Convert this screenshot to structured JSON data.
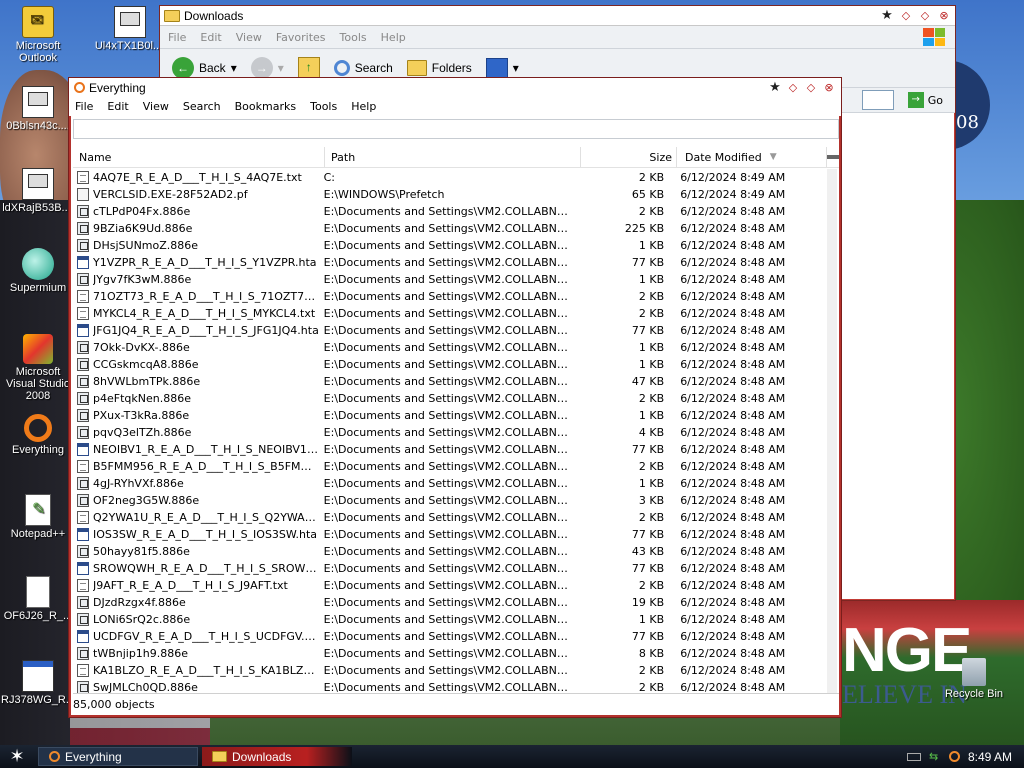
{
  "desktop": {
    "icons": [
      {
        "label": "Microsoft Outlook",
        "icon": "outlook-icon"
      },
      {
        "label": "Ul4xTX1B0l....",
        "icon": "exe-icon"
      },
      {
        "label": "0Bblsn43c....",
        "icon": "exe-icon"
      },
      {
        "label": "ldXRajB53B....",
        "icon": "exe-icon"
      },
      {
        "label": "Supermium",
        "icon": "browser-icon"
      },
      {
        "label": "Microsoft Visual Studio 2008",
        "icon": "visual-studio-icon"
      },
      {
        "label": "Everything",
        "icon": "everything-icon"
      },
      {
        "label": "Notepad++",
        "icon": "notepad-plus-plus-icon"
      },
      {
        "label": "OF6J26_R_...",
        "icon": "document-icon"
      },
      {
        "label": "RJ378WG_R...",
        "icon": "window-icon"
      },
      {
        "label": "Recycle Bin",
        "icon": "recycle-bin-icon"
      }
    ],
    "wallpaper_text": {
      "headline": "NGE",
      "tagline": "ELIEVE IN",
      "badge": "08"
    }
  },
  "downloads_window": {
    "title": "Downloads",
    "menu": [
      "File",
      "Edit",
      "View",
      "Favorites",
      "Tools",
      "Help"
    ],
    "toolbar": {
      "back": "Back",
      "search": "Search",
      "folders": "Folders"
    },
    "go": "Go"
  },
  "everything_window": {
    "title": "Everything",
    "menu": [
      "File",
      "Edit",
      "View",
      "Search",
      "Bookmarks",
      "Tools",
      "Help"
    ],
    "search_value": "",
    "columns": {
      "name": "Name",
      "path": "Path",
      "size": "Size",
      "date": "Date Modified"
    },
    "rows": [
      {
        "icon": "txt",
        "name": "4AQ7E_R_E_A_D___T_H_I_S_4AQ7E.txt",
        "path": "C:",
        "size": "2 KB",
        "date": "6/12/2024 8:49 AM"
      },
      {
        "icon": "pf",
        "name": "VERCLSID.EXE-28F52AD2.pf",
        "path": "E:\\WINDOWS\\Prefetch",
        "size": "65 KB",
        "date": "6/12/2024 8:49 AM"
      },
      {
        "icon": "e886",
        "name": "cTLPdP04Fx.886e",
        "path": "E:\\Documents and Settings\\VM2.COLLABNET\\Ap...",
        "size": "2 KB",
        "date": "6/12/2024 8:48 AM"
      },
      {
        "icon": "e886",
        "name": "9BZia6K9Ud.886e",
        "path": "E:\\Documents and Settings\\VM2.COLLABNET\\Ap...",
        "size": "225 KB",
        "date": "6/12/2024 8:48 AM"
      },
      {
        "icon": "e886",
        "name": "DHsjSUNmoZ.886e",
        "path": "E:\\Documents and Settings\\VM2.COLLABNET\\Ap...",
        "size": "1 KB",
        "date": "6/12/2024 8:48 AM"
      },
      {
        "icon": "hta",
        "name": "Y1VZPR_R_E_A_D___T_H_I_S_Y1VZPR.hta",
        "path": "E:\\Documents and Settings\\VM2.COLLABNET\\Ap...",
        "size": "77 KB",
        "date": "6/12/2024 8:48 AM"
      },
      {
        "icon": "e886",
        "name": "JYgv7fK3wM.886e",
        "path": "E:\\Documents and Settings\\VM2.COLLABNET\\Ap...",
        "size": "1 KB",
        "date": "6/12/2024 8:48 AM"
      },
      {
        "icon": "txt",
        "name": "71OZT73_R_E_A_D___T_H_I_S_71OZT73.txt",
        "path": "E:\\Documents and Settings\\VM2.COLLABNET\\Ap...",
        "size": "2 KB",
        "date": "6/12/2024 8:48 AM"
      },
      {
        "icon": "txt",
        "name": "MYKCL4_R_E_A_D___T_H_I_S_MYKCL4.txt",
        "path": "E:\\Documents and Settings\\VM2.COLLABNET\\Ap...",
        "size": "2 KB",
        "date": "6/12/2024 8:48 AM"
      },
      {
        "icon": "hta",
        "name": "JFG1JQ4_R_E_A_D___T_H_I_S_JFG1JQ4.hta",
        "path": "E:\\Documents and Settings\\VM2.COLLABNET\\Ap...",
        "size": "77 KB",
        "date": "6/12/2024 8:48 AM"
      },
      {
        "icon": "e886",
        "name": "7Okk-DvKX-.886e",
        "path": "E:\\Documents and Settings\\VM2.COLLABNET\\Ap...",
        "size": "1 KB",
        "date": "6/12/2024 8:48 AM"
      },
      {
        "icon": "e886",
        "name": "CCGskmcqA8.886e",
        "path": "E:\\Documents and Settings\\VM2.COLLABNET\\Ap...",
        "size": "1 KB",
        "date": "6/12/2024 8:48 AM"
      },
      {
        "icon": "e886",
        "name": "8hVWLbmTPk.886e",
        "path": "E:\\Documents and Settings\\VM2.COLLABNET\\Ap...",
        "size": "47 KB",
        "date": "6/12/2024 8:48 AM"
      },
      {
        "icon": "e886",
        "name": "p4eFtqkNen.886e",
        "path": "E:\\Documents and Settings\\VM2.COLLABNET\\Ap...",
        "size": "2 KB",
        "date": "6/12/2024 8:48 AM"
      },
      {
        "icon": "e886",
        "name": "PXux-T3kRa.886e",
        "path": "E:\\Documents and Settings\\VM2.COLLABNET\\Ap...",
        "size": "1 KB",
        "date": "6/12/2024 8:48 AM"
      },
      {
        "icon": "e886",
        "name": "pqvQ3elTZh.886e",
        "path": "E:\\Documents and Settings\\VM2.COLLABNET\\Ap...",
        "size": "4 KB",
        "date": "6/12/2024 8:48 AM"
      },
      {
        "icon": "hta",
        "name": "NEOIBV1_R_E_A_D___T_H_I_S_NEOIBV1.hta",
        "path": "E:\\Documents and Settings\\VM2.COLLABNET\\Ap...",
        "size": "77 KB",
        "date": "6/12/2024 8:48 AM"
      },
      {
        "icon": "txt",
        "name": "B5FMM956_R_E_A_D___T_H_I_S_B5FMM956...",
        "path": "E:\\Documents and Settings\\VM2.COLLABNET\\Ap...",
        "size": "2 KB",
        "date": "6/12/2024 8:48 AM"
      },
      {
        "icon": "e886",
        "name": "4gJ-RYhVXf.886e",
        "path": "E:\\Documents and Settings\\VM2.COLLABNET\\Ap...",
        "size": "1 KB",
        "date": "6/12/2024 8:48 AM"
      },
      {
        "icon": "e886",
        "name": "OF2neg3G5W.886e",
        "path": "E:\\Documents and Settings\\VM2.COLLABNET\\Ap...",
        "size": "3 KB",
        "date": "6/12/2024 8:48 AM"
      },
      {
        "icon": "txt",
        "name": "Q2YWA1U_R_E_A_D___T_H_I_S_Q2YWA1U....",
        "path": "E:\\Documents and Settings\\VM2.COLLABNET\\Ap...",
        "size": "2 KB",
        "date": "6/12/2024 8:48 AM"
      },
      {
        "icon": "hta",
        "name": "IOS3SW_R_E_A_D___T_H_I_S_IOS3SW.hta",
        "path": "E:\\Documents and Settings\\VM2.COLLABNET\\Ap...",
        "size": "77 KB",
        "date": "6/12/2024 8:48 AM"
      },
      {
        "icon": "e886",
        "name": "50hayy81f5.886e",
        "path": "E:\\Documents and Settings\\VM2.COLLABNET\\Ap...",
        "size": "43 KB",
        "date": "6/12/2024 8:48 AM"
      },
      {
        "icon": "hta",
        "name": "SROWQWH_R_E_A_D___T_H_I_S_SROWQ...",
        "path": "E:\\Documents and Settings\\VM2.COLLABNET\\Ap...",
        "size": "77 KB",
        "date": "6/12/2024 8:48 AM"
      },
      {
        "icon": "txt",
        "name": "J9AFT_R_E_A_D___T_H_I_S_J9AFT.txt",
        "path": "E:\\Documents and Settings\\VM2.COLLABNET\\Ap...",
        "size": "2 KB",
        "date": "6/12/2024 8:48 AM"
      },
      {
        "icon": "e886",
        "name": "DJzdRzgx4f.886e",
        "path": "E:\\Documents and Settings\\VM2.COLLABNET\\Ap...",
        "size": "19 KB",
        "date": "6/12/2024 8:48 AM"
      },
      {
        "icon": "e886",
        "name": "LONi6SrQ2c.886e",
        "path": "E:\\Documents and Settings\\VM2.COLLABNET\\Ap...",
        "size": "1 KB",
        "date": "6/12/2024 8:48 AM"
      },
      {
        "icon": "hta",
        "name": "UCDFGV_R_E_A_D___T_H_I_S_UCDFGV.hta",
        "path": "E:\\Documents and Settings\\VM2.COLLABNET\\Ap...",
        "size": "77 KB",
        "date": "6/12/2024 8:48 AM"
      },
      {
        "icon": "e886",
        "name": "tWBnjip1h9.886e",
        "path": "E:\\Documents and Settings\\VM2.COLLABNET\\Ap...",
        "size": "8 KB",
        "date": "6/12/2024 8:48 AM"
      },
      {
        "icon": "txt",
        "name": "KA1BLZO_R_E_A_D___T_H_I_S_KA1BLZO.txt",
        "path": "E:\\Documents and Settings\\VM2.COLLABNET\\Ap...",
        "size": "2 KB",
        "date": "6/12/2024 8:48 AM"
      },
      {
        "icon": "e886",
        "name": "SwJMLCh0QD.886e",
        "path": "E:\\Documents and Settings\\VM2.COLLABNET\\Ap...",
        "size": "2 KB",
        "date": "6/12/2024 8:48 AM"
      }
    ],
    "status": "85,000 objects"
  },
  "taskbar": {
    "tasks": [
      {
        "label": "Everything",
        "icon": "everything-icon",
        "active": true
      },
      {
        "label": "Downloads",
        "icon": "folder-icon",
        "active": false
      }
    ],
    "clock": "8:49 AM"
  },
  "colors": {
    "window_border": "#b3322d",
    "accent": "#e9731b",
    "taskbar": "#0b1018"
  }
}
